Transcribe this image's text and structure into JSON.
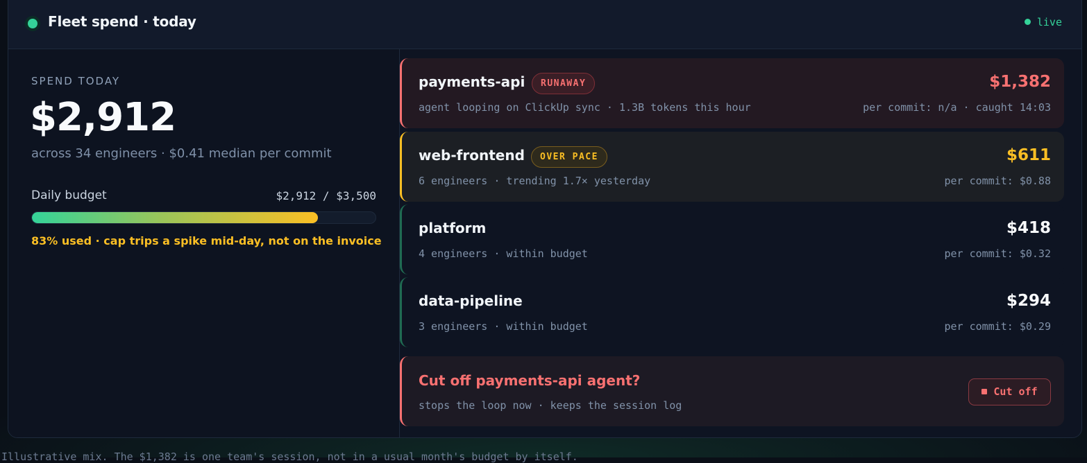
{
  "header": {
    "title": "Fleet spend · today",
    "live_label": "live"
  },
  "summary": {
    "label": "SPEND TODAY",
    "total": "$2,912",
    "subtitle": "across 34 engineers · $0.41 median per commit",
    "budget_label": "Daily budget",
    "budget_value": "$2,912 / $3,500",
    "budget_fraction": 0.832,
    "budget_note": "83% used · cap trips a spike mid-day, not on the invoice"
  },
  "teams": [
    {
      "name": "payments-api",
      "badge": "RUNAWAY",
      "amount": "$1,382",
      "detail": "agent looping on ClickUp sync · 1.3B tokens this hour",
      "per_commit": "per commit: n/a · caught 14:03"
    },
    {
      "name": "web-frontend",
      "badge": "OVER PACE",
      "amount": "$611",
      "detail": "6 engineers · trending 1.7× yesterday",
      "per_commit": "per commit: $0.88"
    },
    {
      "name": "platform",
      "amount": "$418",
      "detail": "4 engineers · within budget",
      "per_commit": "per commit: $0.32"
    },
    {
      "name": "data-pipeline",
      "amount": "$294",
      "detail": "3 engineers · within budget",
      "per_commit": "per commit: $0.29"
    }
  ],
  "action": {
    "title": "Cut off payments-api agent?",
    "subtitle": "stops the loop now · keeps the session log",
    "button_label": "Cut off"
  },
  "footnote": "Illustrative mix. The $1,382 is one team's session, not in a usual month's budget by itself."
}
